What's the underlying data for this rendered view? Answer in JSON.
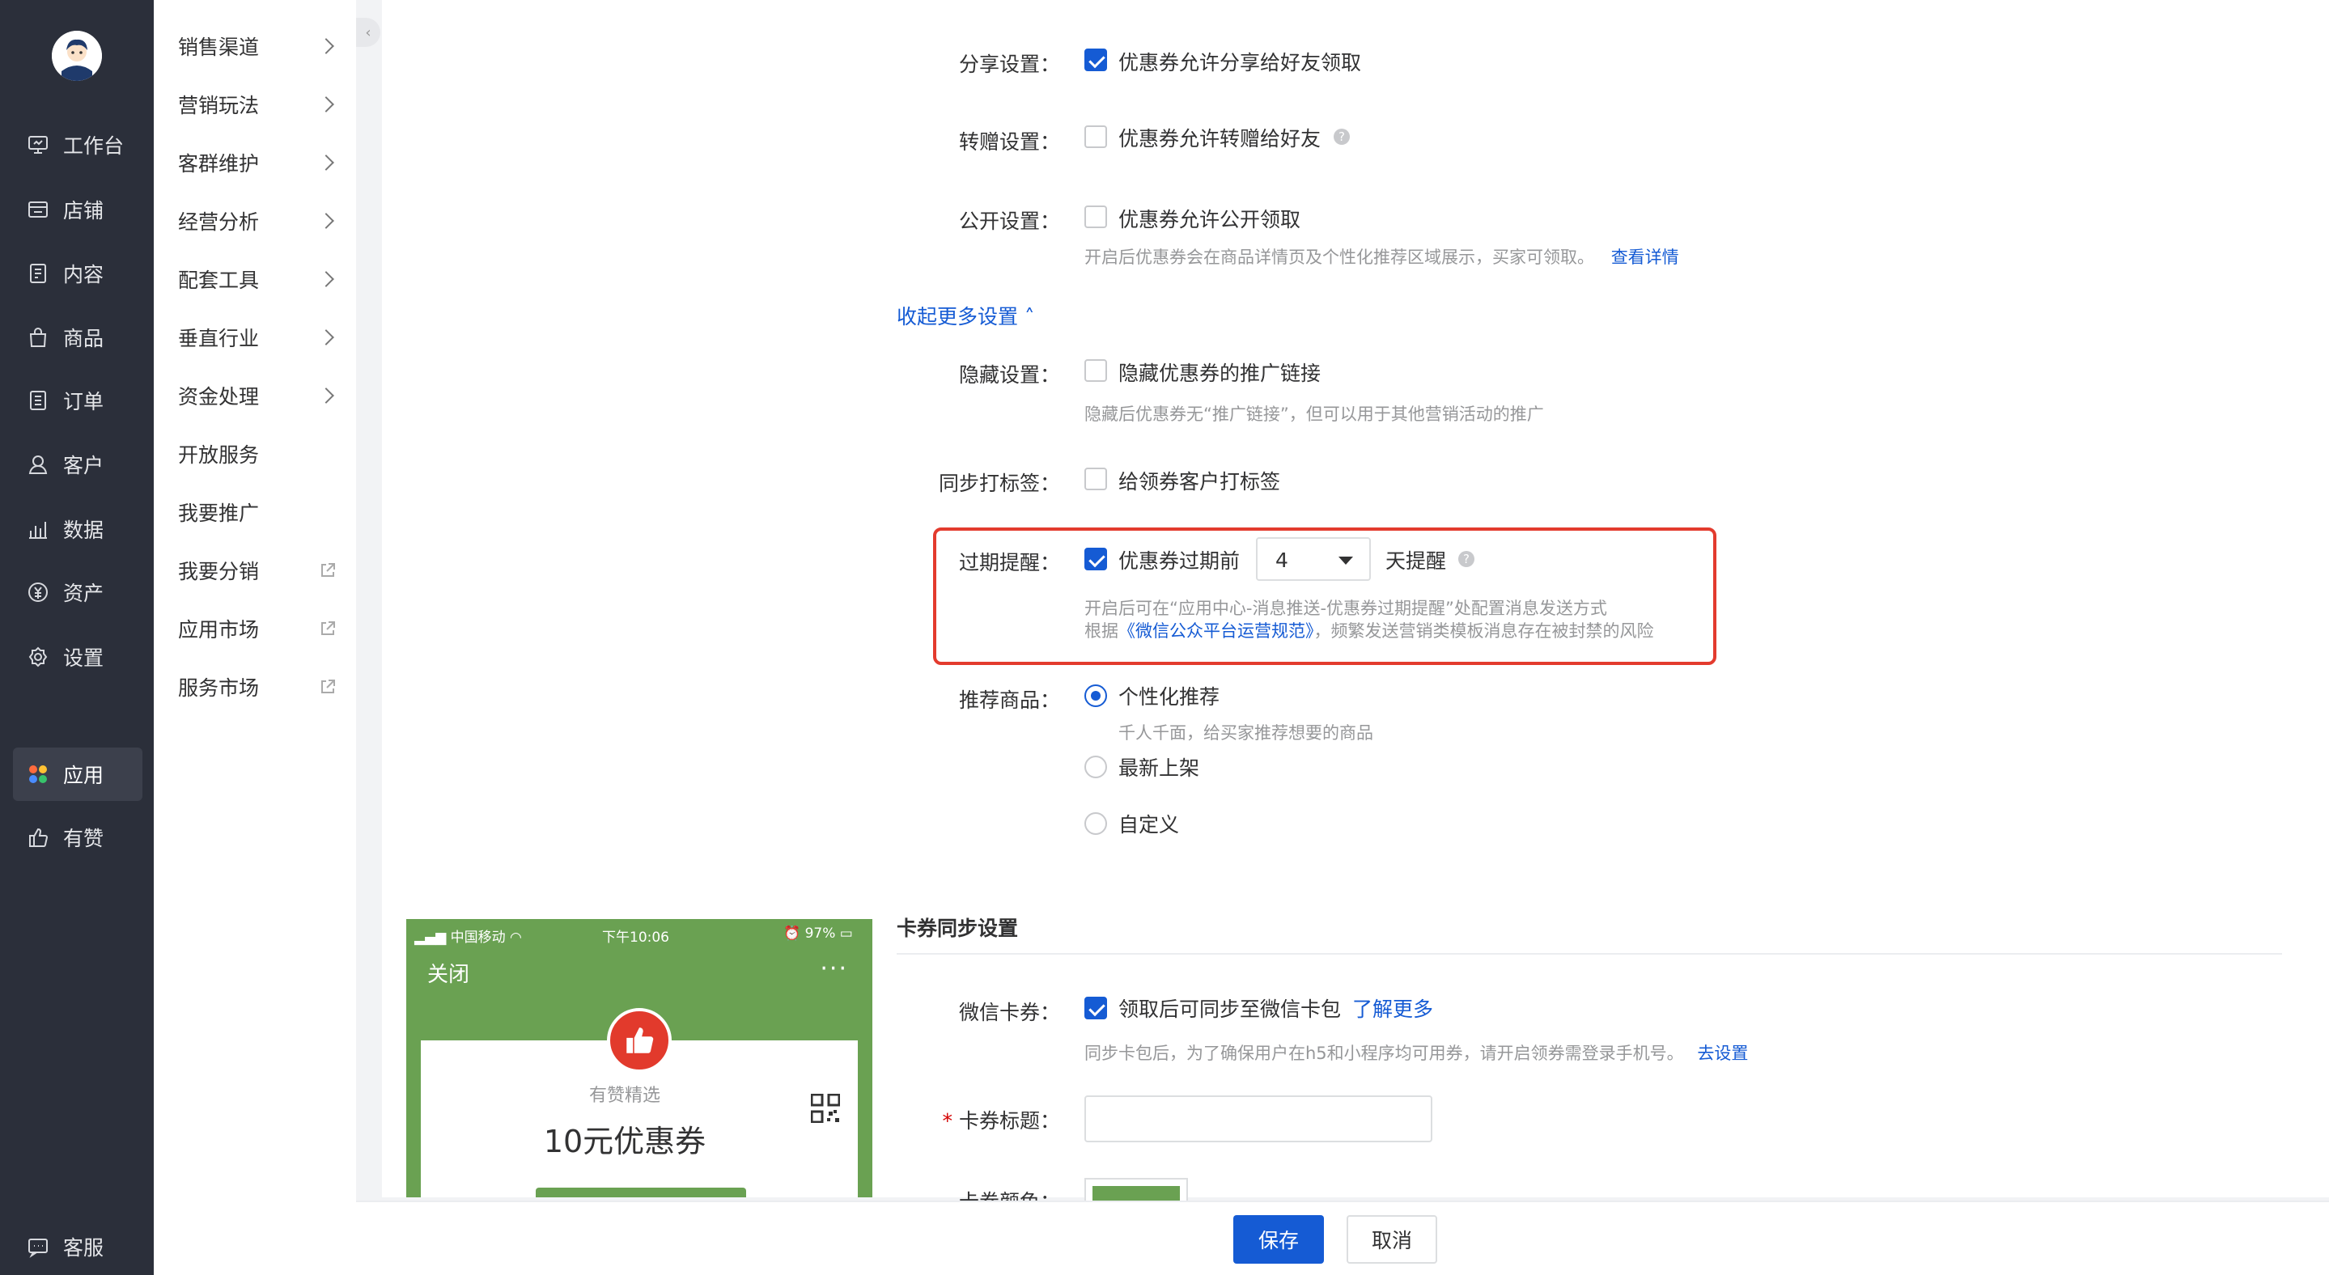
{
  "nav": {
    "items": [
      {
        "label": "工作台",
        "icon": "workbench-icon"
      },
      {
        "label": "店铺",
        "icon": "store-icon"
      },
      {
        "label": "内容",
        "icon": "content-icon"
      },
      {
        "label": "商品",
        "icon": "goods-icon"
      },
      {
        "label": "订单",
        "icon": "order-icon"
      },
      {
        "label": "客户",
        "icon": "customer-icon"
      },
      {
        "label": "数据",
        "icon": "data-icon"
      },
      {
        "label": "资产",
        "icon": "asset-icon"
      },
      {
        "label": "设置",
        "icon": "settings-icon"
      }
    ],
    "apps": {
      "label": "应用"
    },
    "youzan": {
      "label": "有赞"
    },
    "service": {
      "label": "客服"
    }
  },
  "subnav": {
    "items": [
      "销售渠道",
      "营销玩法",
      "客群维护",
      "经营分析",
      "配套工具",
      "垂直行业",
      "资金处理",
      "开放服务",
      "我要推广",
      "我要分销",
      "应用市场",
      "服务市场"
    ]
  },
  "form": {
    "share": {
      "label": "分享设置：",
      "text": "优惠券允许分享给好友领取"
    },
    "gift": {
      "label": "转赠设置：",
      "text": "优惠券允许转赠给好友"
    },
    "public": {
      "label": "公开设置：",
      "text": "优惠券允许公开领取",
      "hint": "开启后优惠券会在商品详情页及个性化推荐区域展示，买家可领取。",
      "hint_link": "查看详情"
    },
    "collapse_link": "收起更多设置 ˄",
    "hide": {
      "label": "隐藏设置：",
      "text": "隐藏优惠券的推广链接",
      "hint": "隐藏后优惠券无“推广链接”，但可以用于其他营销活动的推广"
    },
    "tag": {
      "label": "同步打标签：",
      "text": "给领券客户打标签"
    },
    "expire": {
      "label": "过期提醒：",
      "text_before": "优惠券过期前",
      "days": "4",
      "text_after": "天提醒",
      "hint1": "开启后可在“应用中心-消息推送-优惠券过期提醒”处配置消息发送方式",
      "hint2_prefix": "根据",
      "hint2_link": "《微信公众平台运营规范》",
      "hint2_suffix": "，频繁发送营销类模板消息存在被封禁的风险"
    },
    "recommend": {
      "label": "推荐商品：",
      "opt1": "个性化推荐",
      "opt1_hint": "千人千面，给买家推荐想要的商品",
      "opt2": "最新上架",
      "opt3": "自定义"
    },
    "card_section": "卡券同步设置",
    "wechat_card": {
      "label": "微信卡券：",
      "text": "领取后可同步至微信卡包",
      "link": "了解更多",
      "hint": "同步卡包后，为了确保用户在h5和小程序均可用券，请开启领券需登录手机号。",
      "hint_link": "去设置"
    },
    "card_title": {
      "required": "*",
      "label": "卡券标题："
    },
    "card_color": {
      "label": "卡券颜色："
    }
  },
  "phone": {
    "carrier": "中国移动",
    "time": "下午10:06",
    "battery": "97%",
    "close": "关闭",
    "more": "···",
    "shop": "有赞精选",
    "coupon": "10元优惠券"
  },
  "footer": {
    "save": "保存",
    "cancel": "取消"
  },
  "colors": {
    "primary": "#155bd4",
    "highlight": "#e33b2e",
    "wechat_green": "#6aa152",
    "nav_bg": "#2b2f3a"
  }
}
